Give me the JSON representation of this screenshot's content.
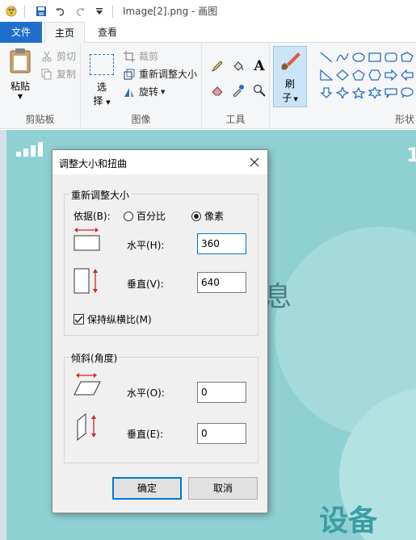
{
  "window": {
    "title": "Image[2].png - 画图"
  },
  "tabs": {
    "file": "文件",
    "home": "主页",
    "view": "查看"
  },
  "ribbon": {
    "clipboard": {
      "label": "剪贴板",
      "paste": "粘贴",
      "cut": "剪切",
      "copy": "复制"
    },
    "image": {
      "label": "图像",
      "select_line1": "选",
      "select_line2": "择",
      "crop": "裁剪",
      "resize": "重新调整大小",
      "rotate": "旋转"
    },
    "tools": {
      "label": "工具"
    },
    "brush": {
      "line1": "刷",
      "line2": "子"
    },
    "shapes": {
      "label": "形状"
    }
  },
  "canvas": {
    "glyph": "息",
    "word": "设备",
    "digit": "1"
  },
  "dialog": {
    "title": "调整大小和扭曲",
    "resize_section": "重新调整大小",
    "by_label": "依据(B):",
    "percent": "百分比",
    "pixels": "像素",
    "unit_selected": "pixels",
    "horizontal_label": "水平(H):",
    "horizontal_value": "360",
    "vertical_label": "垂直(V):",
    "vertical_value": "640",
    "keep_ratio": "保持纵横比(M)",
    "keep_ratio_checked": true,
    "skew_section": "倾斜(角度)",
    "skew_h_label": "水平(O):",
    "skew_h_value": "0",
    "skew_v_label": "垂直(E):",
    "skew_v_value": "0",
    "ok": "确定",
    "cancel": "取消"
  },
  "colors": {
    "accent": "#1e6fcc",
    "canvas_bg": "#8fd1d3",
    "focus": "#0078d7"
  }
}
